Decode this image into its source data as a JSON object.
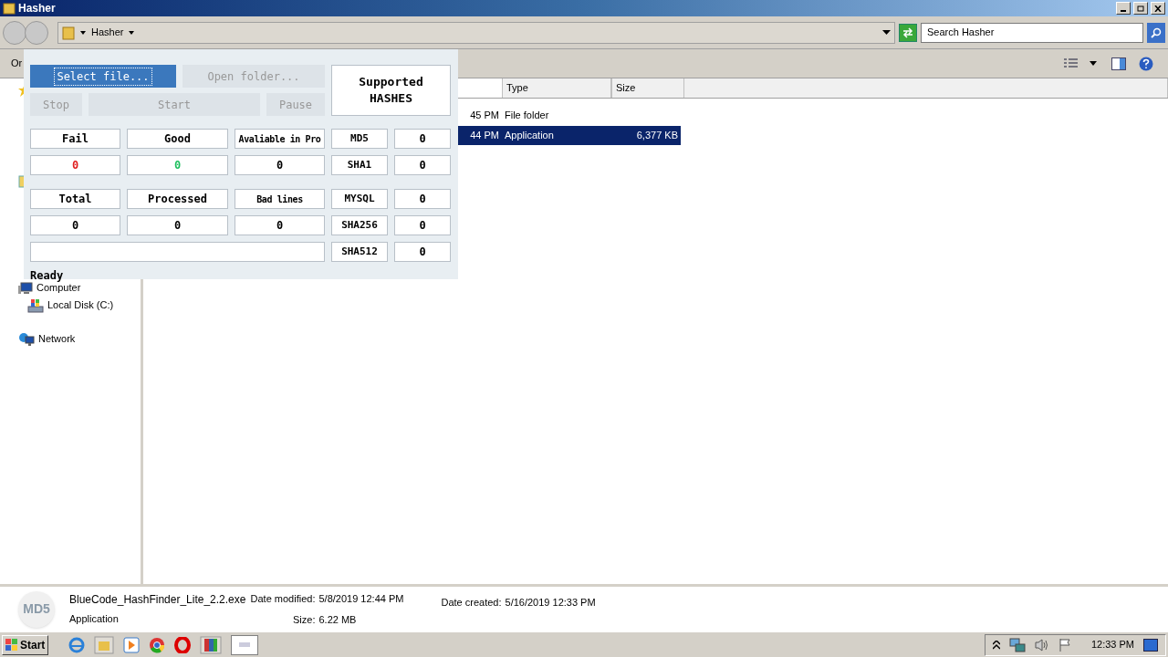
{
  "window": {
    "title": "Hasher"
  },
  "address_bar": {
    "path": "Hasher",
    "search_placeholder": "Search Hasher"
  },
  "toolbar": {
    "organize_partial": "Or"
  },
  "file_list": {
    "columns": [
      {
        "label": "Type"
      },
      {
        "label": "Size"
      }
    ],
    "rows": [
      {
        "modified_partial": "45 PM",
        "type": "File folder",
        "selected": false
      },
      {
        "modified_partial": "44 PM",
        "type": "Application",
        "size": "6,377 KB",
        "selected": true
      }
    ]
  },
  "nav_pane": {
    "items": [
      {
        "label": "Computer",
        "kind": "computer",
        "children": [
          {
            "label": "Local Disk (C:)",
            "kind": "disk"
          }
        ]
      },
      {
        "label": "Network",
        "kind": "network"
      }
    ]
  },
  "hasher_app": {
    "buttons": [
      {
        "label": "Select file...",
        "kind": "primary",
        "disabled": false
      },
      {
        "label": "Open folder...",
        "kind": "plain",
        "disabled": true
      },
      {
        "label": "Stop",
        "kind": "plain",
        "disabled": true
      },
      {
        "label": "Start",
        "kind": "plain",
        "disabled": true
      },
      {
        "label": "Pause",
        "kind": "plain",
        "disabled": true
      }
    ],
    "supported_label": "Supported HASHES",
    "stats": [
      {
        "label": "Fail",
        "value": "0",
        "color": "#e02020"
      },
      {
        "label": "Good",
        "value": "0",
        "color": "#20c060"
      },
      {
        "label": "Avaliable in Pro",
        "value": "0",
        "color": "#000000"
      },
      {
        "label": "Total",
        "value": "0",
        "color": "#000000"
      },
      {
        "label": "Processed",
        "value": "0",
        "color": "#000000"
      },
      {
        "label": "Bad lines",
        "value": "0",
        "color": "#000000"
      }
    ],
    "hashes": [
      {
        "name": "MD5",
        "count": "0"
      },
      {
        "name": "SHA1",
        "count": "0"
      },
      {
        "name": "MYSQL",
        "count": "0"
      },
      {
        "name": "SHA256",
        "count": "0"
      },
      {
        "name": "SHA512",
        "count": "0"
      }
    ],
    "status": "Ready"
  },
  "details_pane": {
    "icon_text": "MD5",
    "file_name": "BlueCode_HashFinder_Lite_2.2.exe",
    "file_type": "Application",
    "fields": [
      {
        "label": "Date modified:",
        "value": "5/8/2019 12:44 PM"
      },
      {
        "label": "Size:",
        "value": "6.22 MB"
      },
      {
        "label": "Date created:",
        "value": "5/16/2019 12:33 PM"
      }
    ]
  },
  "taskbar": {
    "start": "Start",
    "clock": "12:33 PM"
  }
}
